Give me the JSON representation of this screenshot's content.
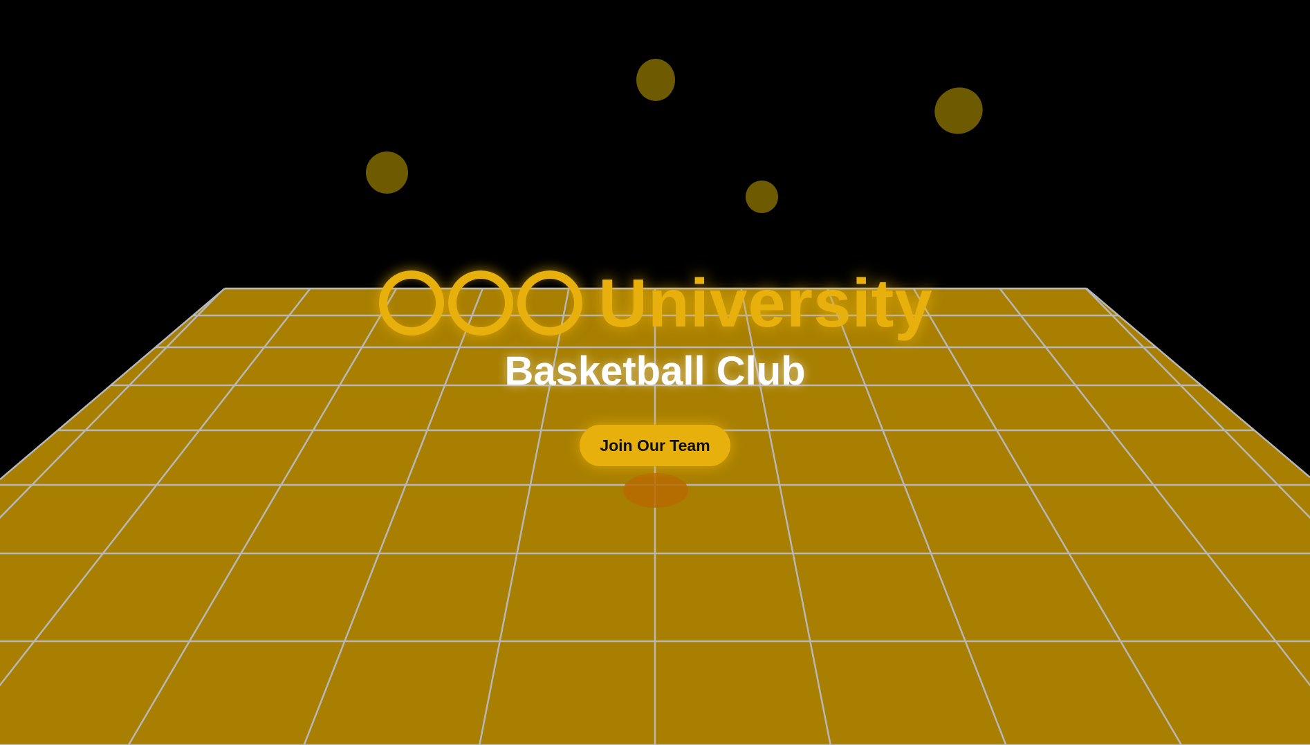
{
  "hero": {
    "brand": "University",
    "subtitle": "Basketball Club",
    "cta_label": "Join Our Team"
  },
  "icons": {
    "logo": "three-rings-icon"
  },
  "colors": {
    "background": "#000000",
    "accent": "#e8b00c",
    "court": "#a87f00",
    "court_lines": "#b8b8b8",
    "ball": "#6e5a00",
    "ball_shadow": "#b86a00",
    "subtitle": "#ffffff"
  }
}
